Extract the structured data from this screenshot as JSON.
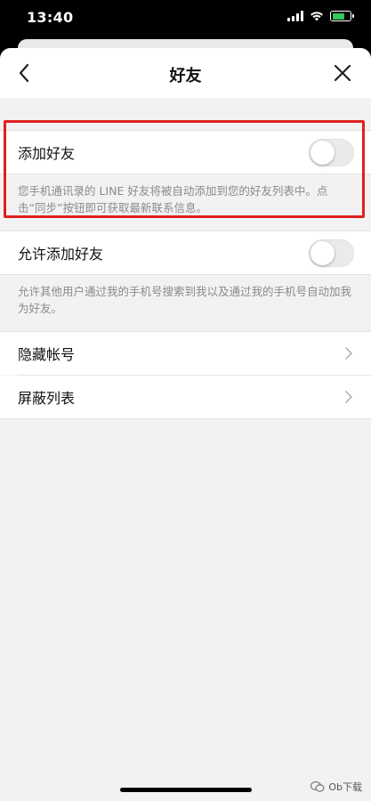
{
  "status_bar": {
    "time": "13:40"
  },
  "header": {
    "title": "好友",
    "back_icon": "chevron-left-icon",
    "close_icon": "close-icon"
  },
  "settings": {
    "add_friends": {
      "label": "添加好友",
      "enabled": false,
      "description": "您手机通讯录的 LINE 好友将被自动添加到您的好友列表中。点击“同步”按钮即可获取最新联系信息。"
    },
    "allow_add": {
      "label": "允许添加好友",
      "enabled": false,
      "description": "允许其他用户通过我的手机号搜索到我以及通过我的手机号自动加我为好友。"
    },
    "hidden_accounts": {
      "label": "隐藏帐号"
    },
    "blocked_list": {
      "label": "屏蔽列表"
    }
  },
  "watermark": {
    "text": "Ob下载"
  },
  "colors": {
    "highlight": "#e0201e",
    "toggle_off": "#ebebeb",
    "background": "#f2f2f2"
  }
}
